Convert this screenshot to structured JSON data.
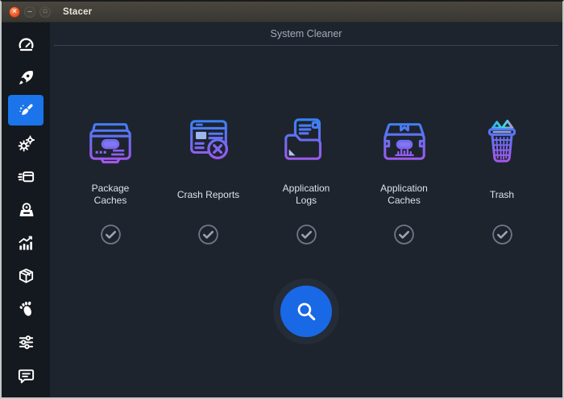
{
  "window": {
    "title": "Stacer",
    "controls": {
      "close": "×",
      "minimize": "–",
      "maximize": "□"
    }
  },
  "header": {
    "title": "System Cleaner"
  },
  "sidebar": {
    "active_item": "system-cleaner",
    "items": [
      {
        "id": "dashboard",
        "icon": "gauge-icon",
        "active": false
      },
      {
        "id": "startup-apps",
        "icon": "rocket-icon",
        "active": false
      },
      {
        "id": "system-cleaner",
        "icon": "broom-icon",
        "active": true
      },
      {
        "id": "services",
        "icon": "gears-icon",
        "active": false
      },
      {
        "id": "processes",
        "icon": "processes-icon",
        "active": false
      },
      {
        "id": "uninstaller",
        "icon": "disc-box-icon",
        "active": false
      },
      {
        "id": "resources",
        "icon": "chart-icon",
        "active": false
      },
      {
        "id": "helpers",
        "icon": "package-box-icon",
        "active": false
      },
      {
        "id": "gnome-settings",
        "icon": "gnome-foot-icon",
        "active": false
      },
      {
        "id": "settings",
        "icon": "sliders-icon",
        "active": false
      },
      {
        "id": "feedback",
        "icon": "chat-bubble-icon",
        "active": false
      }
    ]
  },
  "cleaner": {
    "items": [
      {
        "label": "Package Caches",
        "icon": "package-caches-icon",
        "checked": true
      },
      {
        "label": "Crash Reports",
        "icon": "crash-reports-icon",
        "checked": true
      },
      {
        "label": "Application Logs",
        "icon": "application-logs-icon",
        "checked": true
      },
      {
        "label": "Application Caches",
        "icon": "application-caches-icon",
        "checked": true
      },
      {
        "label": "Trash",
        "icon": "trash-icon",
        "checked": true
      }
    ],
    "scan_button_icon": "search-icon"
  },
  "colors": {
    "titlebar_bg": "#3a3834",
    "close_button": "#ee5a25",
    "sidebar_bg": "#14191f",
    "content_bg": "#1d242e",
    "active_item_blue": "#1b74ea",
    "icon_gradient_top": "#2f86f6",
    "icon_gradient_bottom": "#a855ec",
    "trash_paper_gradient": [
      "#38a8f2",
      "#40d8da",
      "#ef6fd8"
    ],
    "scan_button_blue": "#1968e6",
    "check_gray": "#6e7987",
    "header_text": "#a3acb9",
    "label_text": "#dde1e7"
  }
}
